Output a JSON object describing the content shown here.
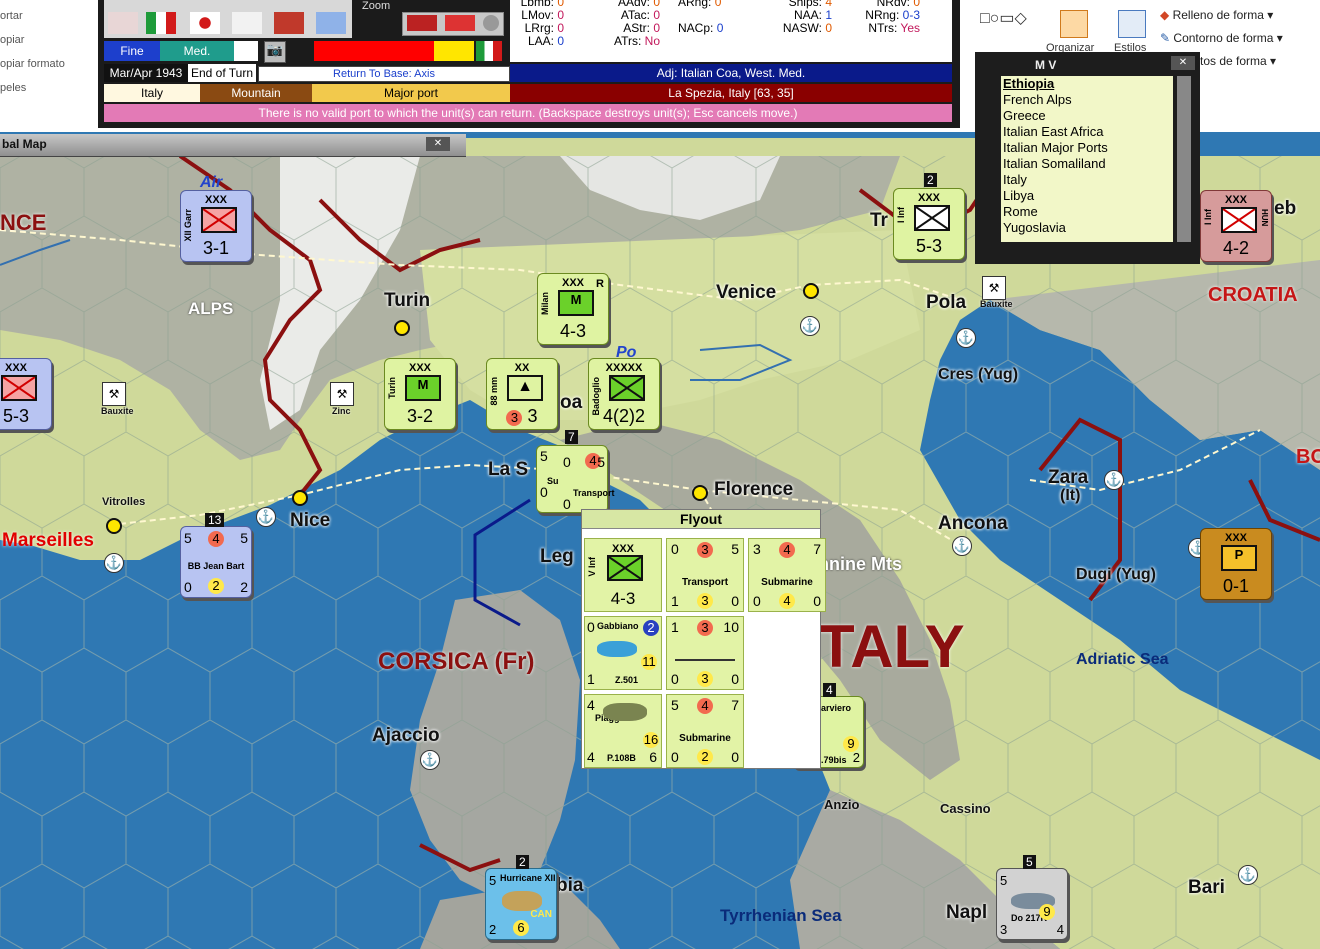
{
  "ribbon": {
    "left_items": [
      "ortar",
      "opiar",
      "opiar formato",
      "peles"
    ],
    "right_buttons": [
      "Relleno de forma",
      "Contorno de forma",
      "tos de forma"
    ],
    "group_labels": [
      "Organizar",
      "Estilos"
    ]
  },
  "game_info": {
    "stats_left": [
      {
        "label": "Lbmb:",
        "value": "0"
      },
      {
        "label": "LMov:",
        "value": "0"
      },
      {
        "label": "LRrg:",
        "value": "0"
      },
      {
        "label": "LAA:",
        "value": "0"
      }
    ],
    "stats_mid": [
      {
        "label": "AAdv:",
        "value": "0"
      },
      {
        "label": "ATac:",
        "value": "0"
      },
      {
        "label": "AStr:",
        "value": "0"
      },
      {
        "label": "ATrs:",
        "value": "No"
      }
    ],
    "stats_mid2": [
      {
        "label": "ARng:",
        "value": "0"
      },
      {
        "label": "NACp:",
        "value": "0"
      }
    ],
    "stats_right": [
      {
        "label": "Ships:",
        "value": "4"
      },
      {
        "label": "NAA:",
        "value": "1"
      },
      {
        "label": "NASW:",
        "value": "0"
      }
    ],
    "stats_far": [
      {
        "label": "NRdv:",
        "value": "0"
      },
      {
        "label": "NRng:",
        "value": "0-3"
      },
      {
        "label": "NTrs:",
        "value": "Yes"
      }
    ],
    "weather": "Fine",
    "sea_area": "Med.",
    "date": "Mar/Apr 1943",
    "phase": "End of Turn",
    "return_base": "Return To Base: Axis",
    "adjacent": "Adj: Italian Coa, West. Med.",
    "nation": "Italy",
    "terrain": "Mountain",
    "port": "Major port",
    "location": "La Spezia, Italy [63, 35]",
    "message": "There is no valid port to which the unit(s) can return. (Backspace destroys unit(s); Esc cancels move.)",
    "zoom_label": "Zoom"
  },
  "global_map": {
    "title": "bal Map"
  },
  "mv_window": {
    "title": "M V",
    "items": [
      "Ethiopia",
      "French Alps",
      "Greece",
      "Italian East Africa",
      "Italian Major Ports",
      "Italian Somaliland",
      "Italy",
      "Libya",
      "Rome",
      "Yugoslavia"
    ]
  },
  "map": {
    "cities": [
      "Turin",
      "Venice",
      "Pola",
      "Nice",
      "Florence",
      "Ancona",
      "Zara",
      "Bari",
      "Ajaccio",
      "La S",
      "Leg",
      "oa",
      "Tr",
      "eb",
      "Napl",
      "bia"
    ],
    "city_sub": {
      "zara": "(It)",
      "cres": "Cres (Yug)",
      "dugi": "Dugi (Yug)"
    },
    "regions": {
      "italy": "TALY",
      "corsica": "CORSICA (Fr)",
      "croatia": "CROATIA",
      "france": "NCE",
      "bo": "BO",
      "marseilles": "Marseilles"
    },
    "white_labels": [
      "ALPS",
      "nnine Mts"
    ],
    "small_labels": [
      "Anzio",
      "Cassino",
      "Vitrolles",
      "Bauxite",
      "Zinc",
      "Bauxite"
    ],
    "seas": [
      "Adriatic Sea",
      "Tyrrhenian Sea"
    ],
    "air_label": "Air",
    "po_label": "Po"
  },
  "counters": [
    {
      "id": "xii-garr",
      "size": "XXX",
      "side": "XII Garr",
      "value": "3-1"
    },
    {
      "id": "milan",
      "size": "XXX",
      "side": "Milan",
      "value": "4-3",
      "corner": "R"
    },
    {
      "id": "turin",
      "size": "XXX",
      "side": "Turin",
      "value": "3-2"
    },
    {
      "id": "aa-88",
      "size": "XX",
      "side": "88 mm",
      "value": "3",
      "red": "3"
    },
    {
      "id": "badoglio",
      "size": "XXXXX",
      "side": "Badoglio",
      "value": "4(2)2"
    },
    {
      "id": "i-inf",
      "size": "XXX",
      "side": "I Inf",
      "value": "5-3",
      "stack": "2"
    },
    {
      "id": "hun",
      "size": "XXX",
      "side": "I Inf",
      "value": "4-2",
      "tag": "HUN"
    },
    {
      "id": "left-edge",
      "size": "XXX",
      "value": "5-3"
    },
    {
      "id": "yug",
      "size": "XXX",
      "value": "0-1",
      "letter": "P"
    }
  ],
  "naval_counters": [
    {
      "id": "jean-bart",
      "name": "BB Jean Bart",
      "top": [
        "5",
        "4",
        "5"
      ],
      "bottom": [
        "0",
        "2",
        "2"
      ],
      "stack": "13"
    },
    {
      "id": "stack-la-spezia",
      "name": "Transport",
      "sub": "Su",
      "top": [
        "5",
        "0",
        "4",
        "5"
      ],
      "bottom": [
        "0",
        "0"
      ],
      "stack": "7"
    },
    {
      "id": "hurricane",
      "name": "Hurricane XII",
      "tag": "CAN",
      "top": [
        "5"
      ],
      "bottom": [
        "2",
        "6"
      ],
      "stack": "2"
    },
    {
      "id": "do217",
      "name": "Do 217K",
      "top": [
        "5"
      ],
      "bottom": [
        "3",
        "9",
        "4"
      ],
      "stack": "5"
    },
    {
      "id": "sparviero",
      "name": "arviero",
      "sub": ".79bis",
      "bottom": [
        "9",
        "2"
      ],
      "stack": "4"
    }
  ],
  "flyout": {
    "title": "Flyout",
    "units": [
      {
        "name": "V Inf",
        "size": "XXX",
        "value": "4-3"
      },
      {
        "name": "Transport",
        "top": [
          "0",
          "3",
          "5"
        ],
        "bottom": [
          "1",
          "3",
          "0"
        ]
      },
      {
        "name": "Submarine",
        "top": [
          "3",
          "4",
          "7"
        ],
        "bottom": [
          "0",
          "4",
          "0"
        ]
      },
      {
        "name": "Gabbiano",
        "model": "Z.501",
        "top": [
          "0",
          "2"
        ],
        "mid": "11",
        "bottom": [
          "1"
        ]
      },
      {
        "name": "Transport",
        "top": [
          "1",
          "3",
          "10"
        ],
        "bottom": [
          "0",
          "3",
          "0"
        ]
      },
      {
        "name": "Piaggio",
        "model": "P.108B",
        "top": [
          "4"
        ],
        "mid": "16",
        "bottom": [
          "4",
          "6"
        ]
      },
      {
        "name": "Submarine",
        "top": [
          "5",
          "4",
          "7"
        ],
        "bottom": [
          "0",
          "2",
          "0"
        ]
      }
    ]
  },
  "colors": {
    "sea": "#2f78b3",
    "land": "#cfd99a",
    "mountain": "#b8b8b8",
    "border": "#8b1010",
    "counter_green": "#dff3a2",
    "weather_blue": "#1d3fcc",
    "adj_navy": "#0a1a8a",
    "location_darkred": "#8a0000",
    "message_pink": "#e37ab6"
  }
}
